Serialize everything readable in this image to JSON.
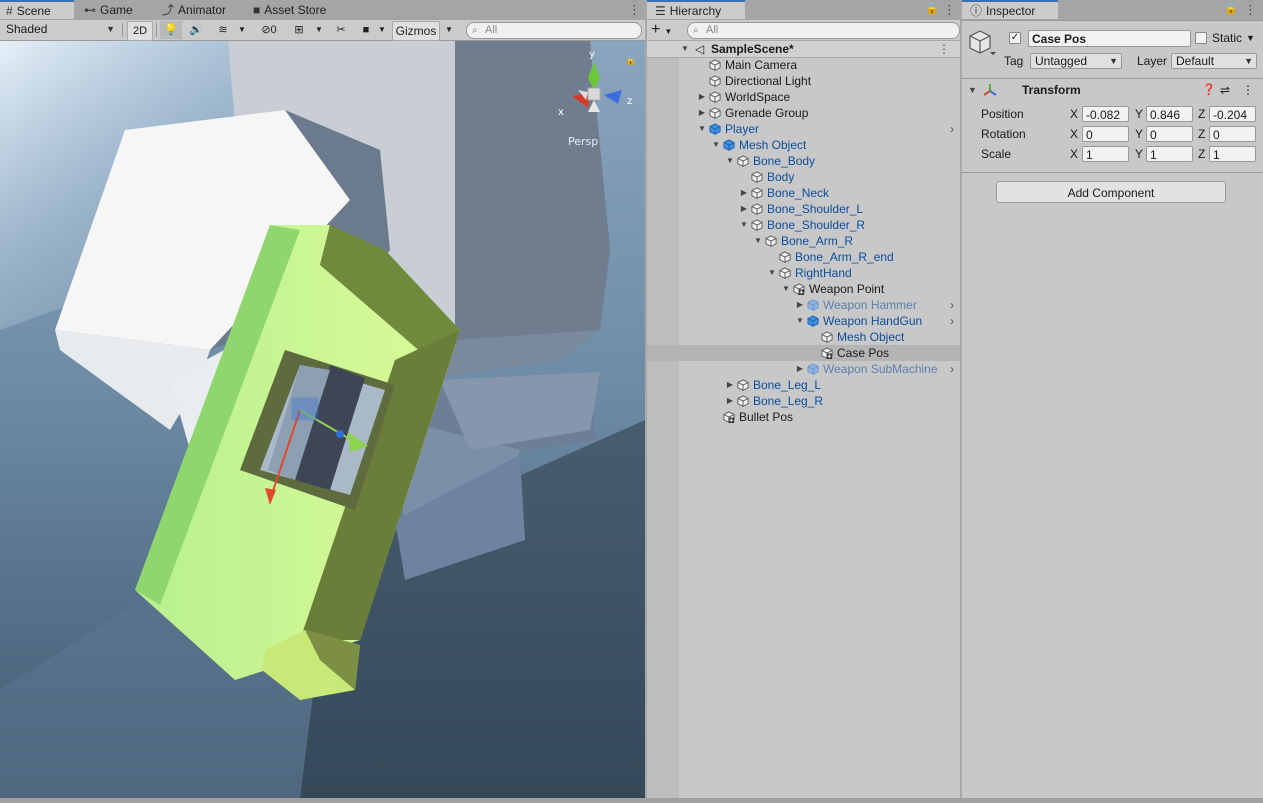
{
  "scene_panel": {
    "tabs": [
      {
        "label": "Scene",
        "icon": "grid-icon"
      },
      {
        "label": "Game",
        "icon": "gamepad-icon"
      },
      {
        "label": "Animator",
        "icon": "animator-icon"
      },
      {
        "label": "Asset Store",
        "icon": "store-icon"
      }
    ],
    "shading_mode": "Shaded",
    "mode_2d": "2D",
    "hidden_count": "0",
    "gizmos_label": "Gizmos",
    "search_placeholder": "All",
    "gizmo_axes": {
      "y": "y",
      "x": "x",
      "z": "z"
    },
    "projection_label": "Persp"
  },
  "hierarchy": {
    "tab_label": "Hierarchy",
    "add_label": "+",
    "search_placeholder": "All",
    "scene_name": "SampleScene*",
    "items": [
      {
        "label": "Main Camera",
        "depth": 0,
        "expand": "none",
        "style": "normal",
        "icon": "cube-icon"
      },
      {
        "label": "Directional Light",
        "depth": 0,
        "expand": "none",
        "style": "normal",
        "icon": "cube-icon"
      },
      {
        "label": "WorldSpace",
        "depth": 0,
        "expand": "collapsed",
        "style": "normal",
        "icon": "cube-icon"
      },
      {
        "label": "Grenade Group",
        "depth": 0,
        "expand": "collapsed",
        "style": "normal",
        "icon": "cube-icon"
      },
      {
        "label": "Player",
        "depth": 0,
        "expand": "expanded",
        "style": "prefab",
        "icon": "prefab-icon",
        "chevron": true
      },
      {
        "label": "Mesh Object",
        "depth": 1,
        "expand": "expanded",
        "style": "prefab",
        "icon": "prefab-icon"
      },
      {
        "label": "Bone_Body",
        "depth": 2,
        "expand": "expanded",
        "style": "prefab",
        "icon": "cube-icon"
      },
      {
        "label": "Body",
        "depth": 3,
        "expand": "none",
        "style": "prefab",
        "icon": "cube-icon"
      },
      {
        "label": "Bone_Neck",
        "depth": 3,
        "expand": "collapsed",
        "style": "prefab",
        "icon": "cube-icon"
      },
      {
        "label": "Bone_Shoulder_L",
        "depth": 3,
        "expand": "collapsed",
        "style": "prefab",
        "icon": "cube-icon"
      },
      {
        "label": "Bone_Shoulder_R",
        "depth": 3,
        "expand": "expanded",
        "style": "prefab",
        "icon": "cube-icon"
      },
      {
        "label": "Bone_Arm_R",
        "depth": 4,
        "expand": "expanded",
        "style": "prefab",
        "icon": "cube-icon"
      },
      {
        "label": "Bone_Arm_R_end",
        "depth": 5,
        "expand": "none",
        "style": "prefab",
        "icon": "cube-icon"
      },
      {
        "label": "RightHand",
        "depth": 5,
        "expand": "expanded",
        "style": "prefab",
        "icon": "cube-icon"
      },
      {
        "label": "Weapon Point",
        "depth": 6,
        "expand": "expanded",
        "style": "added",
        "icon": "added-cube-icon"
      },
      {
        "label": "Weapon Hammer",
        "depth": 7,
        "expand": "collapsed",
        "style": "faded",
        "icon": "prefab-icon",
        "chevron": true
      },
      {
        "label": "Weapon HandGun",
        "depth": 7,
        "expand": "expanded",
        "style": "prefab",
        "icon": "prefab-icon",
        "chevron": true
      },
      {
        "label": "Mesh Object",
        "depth": 8,
        "expand": "none",
        "style": "prefab",
        "icon": "cube-icon"
      },
      {
        "label": "Case Pos",
        "depth": 8,
        "expand": "none",
        "style": "added",
        "icon": "added-cube-icon",
        "selected": true
      },
      {
        "label": "Weapon SubMachine",
        "depth": 7,
        "expand": "collapsed",
        "style": "faded",
        "icon": "prefab-icon",
        "chevron": true
      },
      {
        "label": "Bone_Leg_L",
        "depth": 2,
        "expand": "collapsed",
        "style": "prefab",
        "icon": "cube-icon"
      },
      {
        "label": "Bone_Leg_R",
        "depth": 2,
        "expand": "collapsed",
        "style": "prefab",
        "icon": "cube-icon"
      },
      {
        "label": "Bullet Pos",
        "depth": 1,
        "expand": "none",
        "style": "added",
        "icon": "added-cube-icon"
      }
    ]
  },
  "inspector": {
    "tab_label": "Inspector",
    "object_name": "Case Pos",
    "active_checked": true,
    "static_label": "Static",
    "static_checked": false,
    "tag_label": "Tag",
    "tag_value": "Untagged",
    "layer_label": "Layer",
    "layer_value": "Default",
    "transform": {
      "title": "Transform",
      "rows": [
        {
          "label": "Position",
          "x": "-0.082",
          "y": "0.846",
          "z": "-0.204"
        },
        {
          "label": "Rotation",
          "x": "0",
          "y": "0",
          "z": "0"
        },
        {
          "label": "Scale",
          "x": "1",
          "y": "1",
          "z": "1"
        }
      ],
      "axis_labels": {
        "x": "X",
        "y": "Y",
        "z": "Z"
      }
    },
    "add_component_label": "Add Component"
  },
  "colors": {
    "accent": "#3a72b0",
    "prefab_text": "#0b4d9c",
    "prefab_faded": "#5b7fae",
    "selection": "#b4b4b4"
  }
}
